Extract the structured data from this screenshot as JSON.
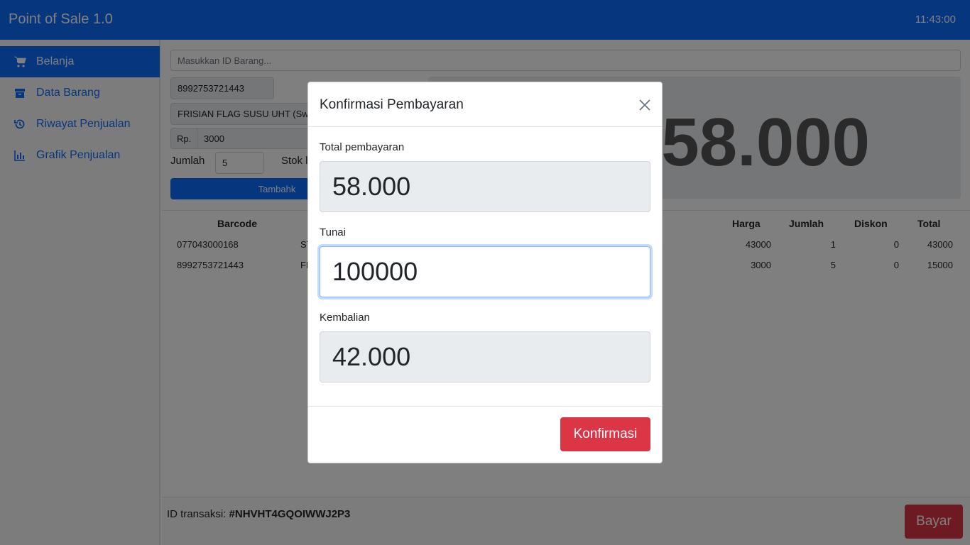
{
  "app": {
    "title": "Point of Sale 1.0",
    "clock": "11:43:00"
  },
  "sidebar": {
    "items": [
      {
        "label": "Belanja",
        "icon": "cart-icon",
        "active": true
      },
      {
        "label": "Data Barang",
        "icon": "archive-icon",
        "active": false
      },
      {
        "label": "Riwayat Penjualan",
        "icon": "history-icon",
        "active": false
      },
      {
        "label": "Grafik Penjualan",
        "icon": "bar-chart-icon",
        "active": false
      }
    ]
  },
  "entry": {
    "search_placeholder": "Masukkan ID Barang...",
    "barcode": "8992753721443",
    "name": "FRISIAN FLAG SUSU UHT (Swi",
    "price_prefix": "Rp.",
    "price": "3000",
    "qty_label": "Jumlah",
    "qty": "5",
    "stock_label": "Stok l",
    "add_button": "Tambahk"
  },
  "big_total": "58.000",
  "table": {
    "headers": {
      "barcode": "Barcode",
      "harga": "Harga",
      "jumlah": "Jumlah",
      "diskon": "Diskon",
      "total": "Total"
    },
    "rows": [
      {
        "barcode": "077043000168",
        "name": "ST",
        "harga": "43000",
        "jumlah": "1",
        "diskon": "0",
        "total": "43000"
      },
      {
        "barcode": "8992753721443",
        "name": "FR",
        "harga": "3000",
        "jumlah": "5",
        "diskon": "0",
        "total": "15000"
      }
    ]
  },
  "footer": {
    "trx_label": "ID transaksi:",
    "trx_id": "#NHVHT4GQOIWWJ2P3",
    "pay_button": "Bayar"
  },
  "modal": {
    "title": "Konfirmasi Pembayaran",
    "total_label": "Total pembayaran",
    "total_value": "58.000",
    "cash_label": "Tunai",
    "cash_value": "100000",
    "change_label": "Kembalian",
    "change_value": "42.000",
    "confirm_button": "Konfirmasi"
  },
  "colors": {
    "primary": "#0d6efd",
    "danger": "#dc3545",
    "overlay": "rgba(0,0,0,0.5)"
  }
}
